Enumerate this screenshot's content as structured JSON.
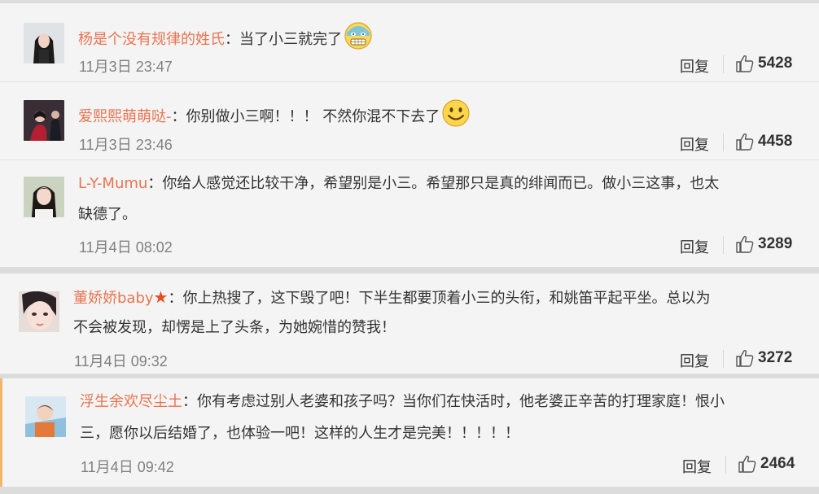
{
  "comments": [
    {
      "username": "杨是个没有规律的姓氏",
      "separator": "：",
      "text_lines": [
        "当了小三就完了"
      ],
      "emoji": "grimace-emoji",
      "time": "11月3日 23:47",
      "reply_label": "回复",
      "likes": "5428"
    },
    {
      "username": "爱熙熙萌萌哒-",
      "separator": "：",
      "text_lines": [
        "你别做小三啊！！！ 不然你混不下去了"
      ],
      "emoji": "smile-emoji",
      "time": "11月3日 23:46",
      "reply_label": "回复",
      "likes": "4458"
    },
    {
      "username": "L-Y-Mumu",
      "separator": "：",
      "text_lines": [
        "你给人感觉还比较干净，希望别是小三。希望那只是真的绯闻而已。做小三这事，也太",
        "缺德了。"
      ],
      "time": "11月4日 08:02",
      "reply_label": "回复",
      "likes": "3289"
    },
    {
      "username": "董娇娇baby",
      "separator": "：",
      "text_lines": [
        "你上热搜了，这下毁了吧！下半生都要顶着小三的头衔，和姚笛平起平坐。总以为",
        "不会被发现，却愣是上了头条，为她婉惜的赞我！"
      ],
      "badge": "★",
      "time": "11月4日 09:32",
      "reply_label": "回复",
      "likes": "3272"
    },
    {
      "username": "浮生余欢尽尘土",
      "separator": "：",
      "text_lines": [
        "你有考虑过别人老婆和孩子吗？当你们在快活时，他老婆正辛苦的打理家庭！恨小",
        "三，愿你以后结婚了，也体验一吧！这样的人生才是完美！！！！！"
      ],
      "time": "11月4日 09:42",
      "reply_label": "回复",
      "likes": "2464"
    }
  ],
  "colors": {
    "username": "#eb7350",
    "text": "#333333",
    "meta": "#808080",
    "background": "#f4f4f4",
    "separator": "#dcdcdc"
  }
}
